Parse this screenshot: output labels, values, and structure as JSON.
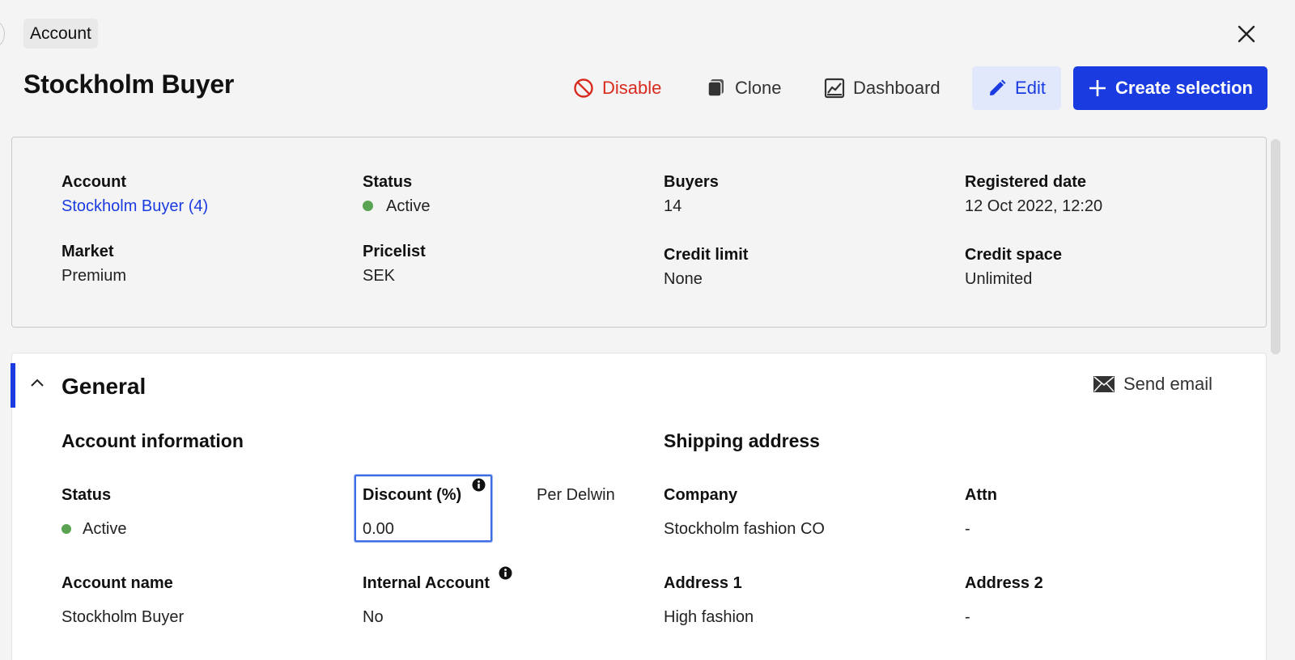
{
  "breadcrumb": {
    "label": "Account"
  },
  "header": {
    "title": "Stockholm Buyer",
    "actions": {
      "disable": "Disable",
      "clone": "Clone",
      "dashboard": "Dashboard",
      "edit": "Edit",
      "create_selection": "Create selection"
    }
  },
  "summary": {
    "account": {
      "label": "Account",
      "value": "Stockholm Buyer (4)"
    },
    "status": {
      "label": "Status",
      "value": "Active"
    },
    "buyers": {
      "label": "Buyers",
      "value": "14"
    },
    "registered_date": {
      "label": "Registered date",
      "value": "12 Oct 2022, 12:20"
    },
    "market": {
      "label": "Market",
      "value": "Premium"
    },
    "pricelist": {
      "label": "Pricelist",
      "value": "SEK"
    },
    "credit_limit": {
      "label": "Credit limit",
      "value": "None"
    },
    "credit_space": {
      "label": "Credit space",
      "value": "Unlimited"
    }
  },
  "general": {
    "title": "General",
    "send_email": "Send email",
    "account_info": {
      "heading": "Account information",
      "status": {
        "label": "Status",
        "value": "Active"
      },
      "discount": {
        "label": "Discount (%)",
        "value": "0.00"
      },
      "owner_link": "Per Delwin",
      "account_name": {
        "label": "Account name",
        "value": "Stockholm Buyer"
      },
      "internal_account": {
        "label": "Internal Account",
        "value": "No"
      }
    },
    "shipping": {
      "heading": "Shipping address",
      "company": {
        "label": "Company",
        "value": "Stockholm fashion CO"
      },
      "attn": {
        "label": "Attn",
        "value": "-"
      },
      "address1": {
        "label": "Address 1",
        "value": "High fashion"
      },
      "address2": {
        "label": "Address 2",
        "value": "-"
      }
    }
  },
  "colors": {
    "accent": "#1a3be0",
    "danger": "#d92a1f",
    "status_active": "#5aa352",
    "focus_outline": "#3d6ee6"
  },
  "icons": [
    "back-icon",
    "close-icon",
    "ban-icon",
    "copy-icon",
    "chart-icon",
    "pencil-icon",
    "plus-icon",
    "chevron-up-icon",
    "envelope-icon",
    "info-icon"
  ]
}
